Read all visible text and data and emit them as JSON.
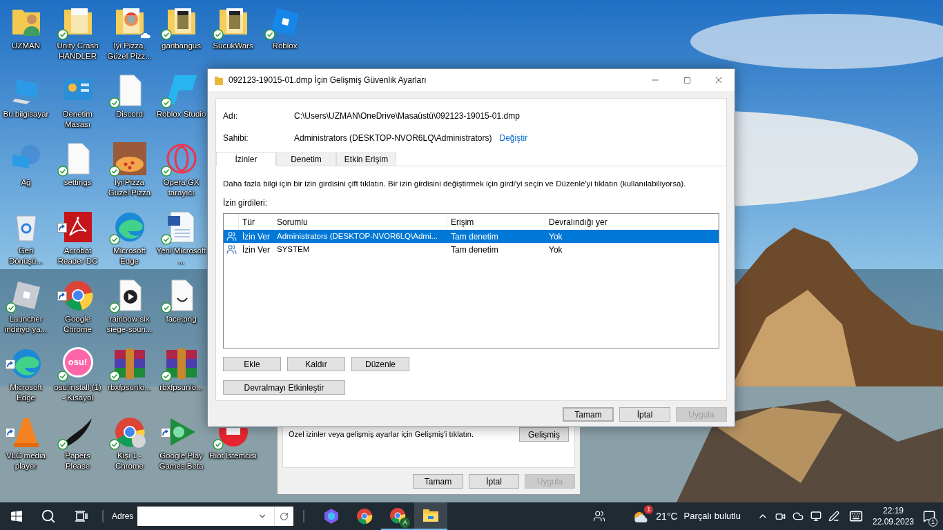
{
  "desktop": {
    "columns": [
      {
        "icons": [
          {
            "label": "UZMAN",
            "kind": "user-folder",
            "synced": false,
            "shortcut": false,
            "cloud": false
          },
          {
            "label": "Bu bilgisayar",
            "kind": "computer",
            "synced": false,
            "shortcut": false,
            "cloud": false
          },
          {
            "label": "Ağ",
            "kind": "network",
            "synced": false,
            "shortcut": false,
            "cloud": false
          },
          {
            "label": "Geri Dönüşü...",
            "kind": "recycle",
            "synced": false,
            "shortcut": false,
            "cloud": false
          },
          {
            "label": "Launcher indiriyo ya...",
            "kind": "launcher",
            "synced": true,
            "shortcut": false,
            "cloud": false
          },
          {
            "label": "Microsoft Edge",
            "kind": "edge",
            "synced": false,
            "shortcut": true,
            "cloud": false
          },
          {
            "label": "VLC media player",
            "kind": "vlc",
            "synced": false,
            "shortcut": true,
            "cloud": false
          }
        ]
      },
      {
        "icons": [
          {
            "label": "Unity Crash HANDLER",
            "kind": "folder",
            "synced": true,
            "shortcut": false,
            "cloud": false
          },
          {
            "label": "Denetim Masası",
            "kind": "control-panel",
            "synced": false,
            "shortcut": false,
            "cloud": false
          },
          {
            "label": "settings",
            "kind": "document",
            "synced": true,
            "shortcut": false,
            "cloud": false
          },
          {
            "label": "Acrobat Reader DC",
            "kind": "acrobat",
            "synced": false,
            "shortcut": true,
            "cloud": false
          },
          {
            "label": "Google Chrome",
            "kind": "chrome",
            "synced": false,
            "shortcut": true,
            "cloud": false
          },
          {
            "label": "osu!install (1) - Kısayol",
            "kind": "osu",
            "synced": true,
            "shortcut": false,
            "cloud": false,
            "logo_text": "osu!"
          },
          {
            "label": "Papers Please",
            "kind": "papers",
            "synced": true,
            "shortcut": false,
            "cloud": false
          }
        ]
      },
      {
        "icons": [
          {
            "label": "İyi Pizza, Güzel Pizz...",
            "kind": "folder-chrome",
            "synced": false,
            "shortcut": false,
            "cloud": true
          },
          {
            "label": "Discord",
            "kind": "document",
            "synced": true,
            "shortcut": false,
            "cloud": false
          },
          {
            "label": "İyi Pizza Güzel Pizza",
            "kind": "pizza",
            "synced": true,
            "shortcut": false,
            "cloud": false
          },
          {
            "label": "Microsoft Edge",
            "kind": "edge",
            "synced": true,
            "shortcut": false,
            "cloud": false
          },
          {
            "label": "rainbow six siege-soun...",
            "kind": "media",
            "synced": true,
            "shortcut": false,
            "cloud": false
          },
          {
            "label": "rbxfpsunlo...",
            "kind": "rar",
            "synced": true,
            "shortcut": false,
            "cloud": false
          },
          {
            "label": "Kişi 1 - Chrome",
            "kind": "chrome-person",
            "synced": true,
            "shortcut": false,
            "cloud": false
          }
        ]
      },
      {
        "icons": [
          {
            "label": "garibangus",
            "kind": "folder-dark",
            "synced": true,
            "shortcut": false,
            "cloud": false
          },
          {
            "label": "Roblox Studio",
            "kind": "roblox-studio",
            "synced": true,
            "shortcut": false,
            "cloud": false
          },
          {
            "label": "Opera GX tarayıcı",
            "kind": "opera",
            "synced": true,
            "shortcut": false,
            "cloud": false
          },
          {
            "label": "Yeni Microsoft ...",
            "kind": "word",
            "synced": true,
            "shortcut": false,
            "cloud": false
          },
          {
            "label": "face.png",
            "kind": "face",
            "synced": true,
            "shortcut": false,
            "cloud": false
          },
          {
            "label": "rbxfpsunlo...",
            "kind": "rar",
            "synced": true,
            "shortcut": false,
            "cloud": false
          },
          {
            "label": "Google Play Games Beta",
            "kind": "play-games",
            "synced": false,
            "shortcut": true,
            "cloud": false
          }
        ]
      },
      {
        "icons": [
          {
            "label": "SucukWars",
            "kind": "folder-dark",
            "synced": true,
            "shortcut": false,
            "cloud": false
          },
          {
            "label": "Riot İstemcisi",
            "kind": "riot",
            "synced": true,
            "shortcut": false,
            "cloud": false
          }
        ]
      },
      {
        "icons": [
          {
            "label": "Roblox",
            "kind": "roblox",
            "synced": true,
            "shortcut": false,
            "cloud": false
          }
        ]
      }
    ]
  },
  "background_dialog": {
    "hint": "Özel izinler veya gelişmiş ayarlar için Gelişmiş'i tıklatın.",
    "advanced_button": "Gelişmiş",
    "buttons": [
      {
        "label": "Tamam",
        "disabled": false
      },
      {
        "label": "İptal",
        "disabled": false
      },
      {
        "label": "Uygula",
        "disabled": true
      }
    ]
  },
  "dialog": {
    "title": "092123-19015-01.dmp İçin Gelişmiş Güvenlik Ayarları",
    "name_label": "Adı:",
    "name_value": "C:\\Users\\UZMAN\\OneDrive\\Masaüstü\\092123-19015-01.dmp",
    "owner_label": "Sahibi:",
    "owner_value": "Administrators (DESKTOP-NVOR6LQ\\Administrators)",
    "owner_link": "Değiştir",
    "tabs": [
      {
        "label": "İzinler",
        "selected": true
      },
      {
        "label": "Denetim",
        "selected": false
      },
      {
        "label": "Etkin Erişim",
        "selected": false
      }
    ],
    "instructions": "Daha fazla bilgi için bir izin girdisini çift tıklatın. Bir izin girdisini değiştirmek için girdi'yi seçin ve Düzenle'yi tıklatın (kullanılabiliyorsa).",
    "entries_label": "İzin girdileri:",
    "table": {
      "columns": [
        "Tür",
        "Sorumlu",
        "Erişim",
        "Devralındığı yer"
      ],
      "rows": [
        {
          "type": "İzin Ver",
          "principal": "Administrators (DESKTOP-NVOR6LQ\\Admi...",
          "access": "Tam denetim",
          "inherited_from": "Yok",
          "selected": true
        },
        {
          "type": "İzin Ver",
          "principal": "SYSTEM",
          "access": "Tam denetim",
          "inherited_from": "Yok",
          "selected": false
        }
      ]
    },
    "entry_buttons": [
      "Ekle",
      "Kaldır",
      "Düzenle"
    ],
    "inheritance_button": "Devralmayı Etkinleştir",
    "buttons": [
      {
        "label": "Tamam",
        "default": true,
        "disabled": false
      },
      {
        "label": "İptal",
        "default": false,
        "disabled": false
      },
      {
        "label": "Uygula",
        "default": false,
        "disabled": true
      }
    ]
  },
  "taskbar": {
    "address_label": "Adres",
    "pinned": [
      {
        "kind": "hexagon",
        "running": false,
        "active": false
      },
      {
        "kind": "chrome",
        "running": false,
        "active": false
      },
      {
        "kind": "chrome-profile",
        "running": true,
        "active": false,
        "profile_letter": "A"
      },
      {
        "kind": "folder",
        "running": true,
        "active": true
      }
    ],
    "weather": {
      "badge": "1",
      "temperature": "21°C",
      "condition": "Parçalı bulutlu"
    },
    "time": "22:19",
    "date": "22.09.2023",
    "notification_count": "1"
  }
}
